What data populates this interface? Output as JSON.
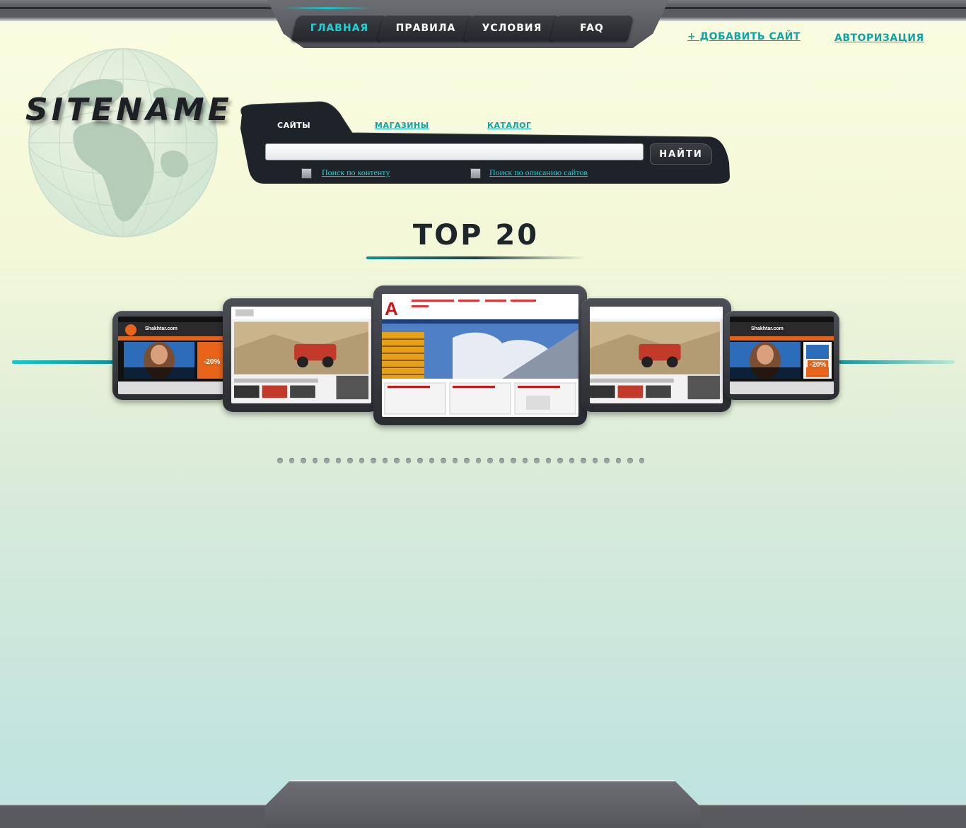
{
  "nav": {
    "tabs": [
      {
        "label": "ГЛАВНАЯ",
        "active": true
      },
      {
        "label": "ПРАВИЛА",
        "active": false
      },
      {
        "label": "УСЛОВИЯ",
        "active": false
      },
      {
        "label": "FAQ",
        "active": false
      }
    ]
  },
  "header_links": {
    "add_site": "+ ДОБАВИТЬ САЙТ",
    "login": "АВТОРИЗАЦИЯ"
  },
  "logo": "SITENAME",
  "search": {
    "tabs": [
      "САЙТЫ",
      "МАГАЗИНЫ",
      "КАТАЛОГ"
    ],
    "active_tab": "САЙТЫ",
    "input_value": "",
    "button": "НАЙТИ",
    "option_content": "Поиск по контенту",
    "option_description": "Поиск по описанию сайтов"
  },
  "top": {
    "title": "TOP 20"
  },
  "carousel": {
    "cards": [
      {
        "site": "Shakhtar.com",
        "promo": "-20%"
      },
      {
        "site": "",
        "promo": ""
      },
      {
        "site": "",
        "promo": ""
      },
      {
        "site": "",
        "promo": ""
      },
      {
        "site": "Shakhtar.com",
        "promo": "-20%"
      }
    ],
    "pages": 32,
    "current_page": 1
  },
  "colors": {
    "accent": "#1fd1d6",
    "link": "#0fa4a6",
    "dark": "#1e252b",
    "chrome": "#5a5b5f"
  },
  "icons": {
    "add": "plus-icon",
    "globe": "globe-icon"
  }
}
